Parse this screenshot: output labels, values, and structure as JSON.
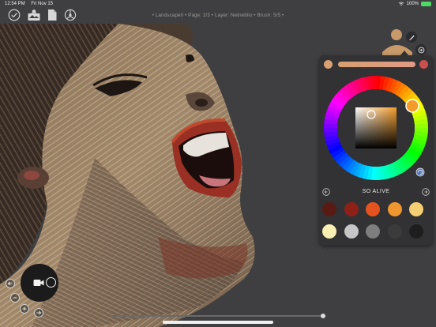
{
  "status_bar": {
    "time": "12:54 PM",
    "date": "Fri Nov 15",
    "battery": "100%"
  },
  "document": {
    "info": "• Landscape0 • Page: 2/3 • Layer: Netneblio • Brush: 5/5 •"
  },
  "toolbar": {
    "icons": [
      "checkmark-icon",
      "gallery-icon",
      "document-icon",
      "settings-icon"
    ]
  },
  "color_panel": {
    "current_color": "#f39c2a",
    "history": [
      "#d8a070",
      "#e09a86",
      "#c85050"
    ],
    "palette_name": "SO ALIVE",
    "palette": [
      "#5a1a14",
      "#8e2018",
      "#e4531f",
      "#f0962e",
      "#f6cf74",
      "#f8f0b2",
      "#c6c6c6",
      "#7e7e7e",
      "#3b3b3b",
      "#1e1e1e"
    ]
  },
  "colors": {
    "accent": "#4cd964",
    "brush_fill": "#c89a6a",
    "panel_bg": "#323234"
  }
}
